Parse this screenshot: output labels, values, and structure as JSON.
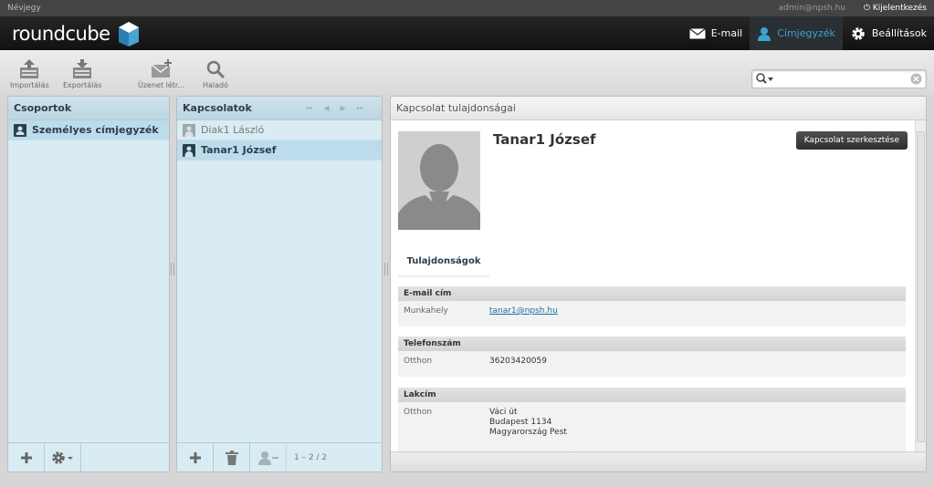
{
  "topline": {
    "title": "Névjegy",
    "user": "admin@npsh.hu",
    "logout": "Kijelentkezés"
  },
  "logo": {
    "text": "roundcube"
  },
  "nav": {
    "email": "E-mail",
    "contacts": "Címjegyzék",
    "settings": "Beállítások"
  },
  "toolbar": {
    "import": "Importálás",
    "export": "Exportálás",
    "compose": "Üzenet létr...",
    "advanced": "Haladó"
  },
  "search": {
    "placeholder": ""
  },
  "groups": {
    "header": "Csoportok",
    "items": [
      {
        "label": "Személyes címjegyzék"
      }
    ]
  },
  "contacts": {
    "header": "Kapcsolatok",
    "items": [
      {
        "label": "Diak1 László"
      },
      {
        "label": "Tanar1 József"
      }
    ],
    "count": "1 – 2 / 2"
  },
  "detail": {
    "header": "Kapcsolat tulajdonságai",
    "name": "Tanar1 József",
    "edit": "Kapcsolat szerkesztése",
    "tab": "Tulajdonságok",
    "email_section": "E-mail cím",
    "email_label": "Munkahely",
    "email_value": "tanar1@npsh.hu",
    "phone_section": "Telefonszám",
    "phone_label": "Otthon",
    "phone_value": "36203420059",
    "address_section": "Lakcím",
    "address_label": "Otthon",
    "address_line1": "Váci út",
    "address_line2": "Budapest 1134",
    "address_line3": "Magyarország Pest"
  },
  "colors": {
    "accent": "#3fa3cf",
    "panel_blue": "#d9ecf4",
    "selection": "#bcdcec"
  }
}
